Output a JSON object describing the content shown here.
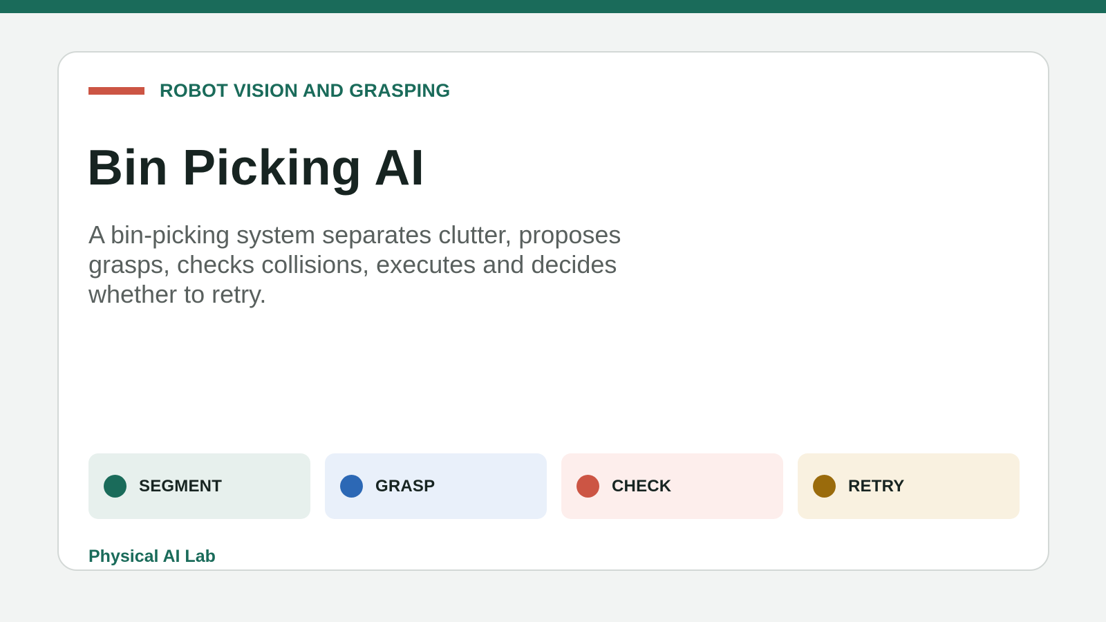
{
  "theme": {
    "brand": "#1a6b5a",
    "accent": "#cc5544",
    "background": "#f2f4f3",
    "card": "#ffffff"
  },
  "header": {
    "eyebrow": "ROBOT VISION AND GRASPING",
    "title": "Bin Picking AI",
    "description": "A bin-picking system separates clutter, proposes grasps, checks collisions, executes and decides whether to retry."
  },
  "steps": [
    {
      "label": "SEGMENT",
      "icon": "green-dot-icon",
      "dot_color": "#1a6b5a",
      "bg_color": "#e7f0ed"
    },
    {
      "label": "GRASP",
      "icon": "blue-dot-icon",
      "dot_color": "#2c68b5",
      "bg_color": "#e9f0fa"
    },
    {
      "label": "CHECK",
      "icon": "red-dot-icon",
      "dot_color": "#cc5544",
      "bg_color": "#fdeeec"
    },
    {
      "label": "RETRY",
      "icon": "amber-dot-icon",
      "dot_color": "#9a6b0c",
      "bg_color": "#f9f1e0"
    }
  ],
  "footer": {
    "label": "Physical AI Lab"
  }
}
